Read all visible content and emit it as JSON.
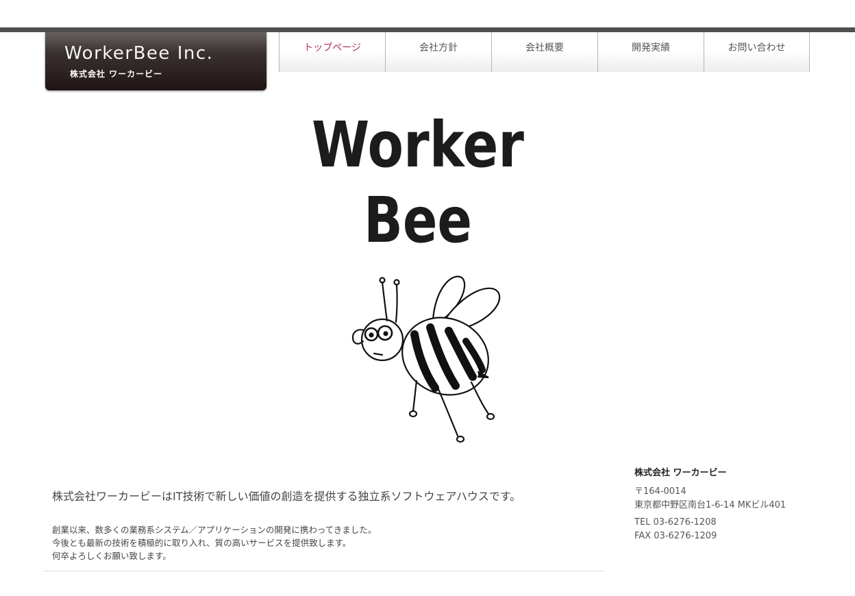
{
  "header": {
    "logo_en": "WorkerBee Inc.",
    "logo_ja": "株式会社 ワーカービー"
  },
  "nav": {
    "items": [
      {
        "label": "トップページ",
        "active": true
      },
      {
        "label": "会社方針"
      },
      {
        "label": "会社概要"
      },
      {
        "label": "開発実績"
      },
      {
        "label": "お問い合わせ"
      }
    ]
  },
  "hero": {
    "line1": "Worker",
    "line2": "Bee"
  },
  "main": {
    "tagline": "株式会社ワーカービーはIT技術で新しい価値の創造を提供する独立系ソフトウェアハウスです。",
    "desc": [
      "創業以来、数多くの業務系システム／アプリケーションの開発に携わってきました。",
      "今後とも最新の技術を積極的に取り入れ、質の高いサービスを提供致します。",
      "何卒よろしくお願い致します。"
    ]
  },
  "sidebar": {
    "company": "株式会社 ワーカービー",
    "postal": "〒164-0014",
    "address": "東京都中野区南台1-6-14 MKビル401",
    "tel": "TEL 03-6276-1208",
    "fax": "FAX 03-6276-1209"
  }
}
